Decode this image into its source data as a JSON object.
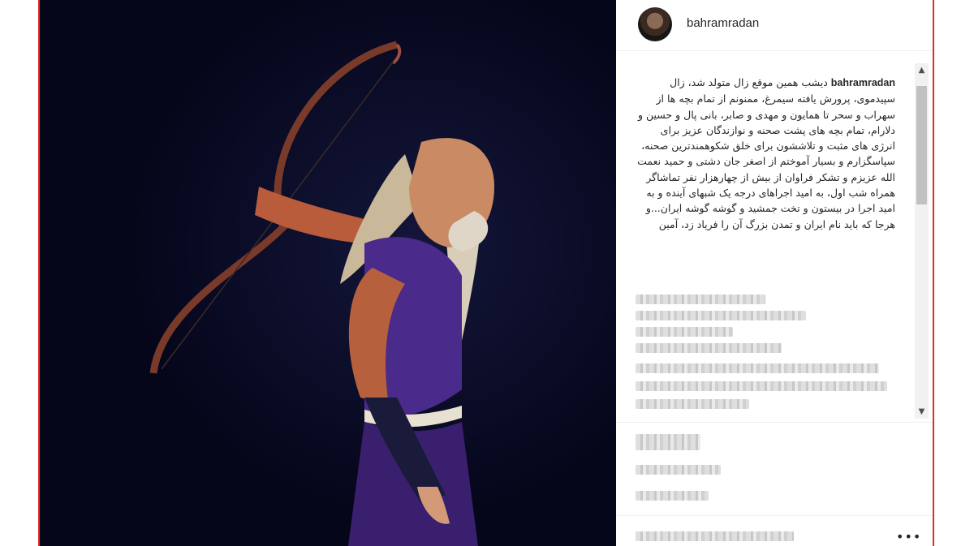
{
  "post": {
    "username": "bahramradan",
    "caption_username": "bahramradan",
    "caption_text": "دیشب همین موقع زال متولد شد، زال سپیدموی، پرورش یافته سیمرغ، ممنونم از تمام بچه ها از سهراب و سحر تا همایون و مهدی و صابر، بانی پال و حسین و دلارام، تمام بچه های پشت صحنه و نوازندگان عزیز برای انرژی های مثبت و تلاششون برای خلق شکوهمندترین صحنه، سپاسگزارم و بسیار آموختم از اصغر جان دشتی و حمید نعمت الله عزیزم و تشکر فراوان از بیش از چهارهزار نفر تماشاگر همراه شب اول، به امید اجراهای درجه یک شبهای آینده و به امید اجرا در بیستون و تخت جمشید و گوشه گوشه ایران...و هرجا که باید نام ایران و تمدن بزرگ آن را فریاد زد، آمین",
    "more_icon": "ellipsis-icon"
  },
  "scrollbar": {
    "up_icon": "▲",
    "down_icon": "▼"
  }
}
